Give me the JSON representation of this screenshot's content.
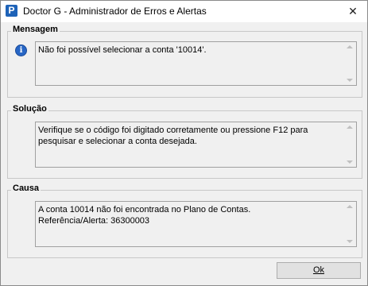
{
  "window": {
    "app_icon_letter": "P",
    "title": "Doctor G - Administrador de Erros e Alertas",
    "close_glyph": "✕"
  },
  "sections": {
    "message": {
      "legend": "Mensagem",
      "icon": "info-icon",
      "text": "Não foi possível selecionar a conta '10014'."
    },
    "solution": {
      "legend": "Solução",
      "text": "Verifique se o código foi digitado corretamente ou pressione F12 para\npesquisar e selecionar a conta desejada."
    },
    "cause": {
      "legend": "Causa",
      "text": "A conta 10014 não foi encontrada no Plano de Contas.\nReferência/Alerta: 36300003"
    }
  },
  "buttons": {
    "ok_label": "Ok"
  }
}
